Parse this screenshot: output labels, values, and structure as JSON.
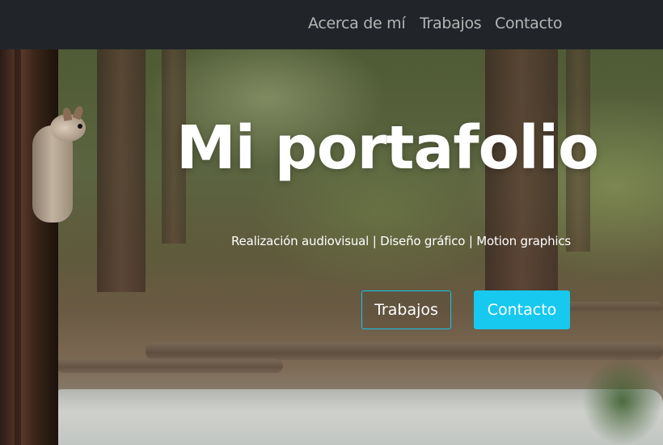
{
  "nav": {
    "items": [
      {
        "label": "Acerca de mí"
      },
      {
        "label": "Trabajos"
      },
      {
        "label": "Contacto"
      }
    ]
  },
  "hero": {
    "title": "Mi portafolio",
    "subtitle": "Realización audiovisual | Diseño gráfico | Motion graphics",
    "buttons": {
      "works": "Trabajos",
      "contact": "Contacto"
    }
  },
  "colors": {
    "navbar_bg": "#212529",
    "nav_text": "#b5b5b5",
    "accent": "#17c9ef",
    "text": "#ffffff"
  }
}
